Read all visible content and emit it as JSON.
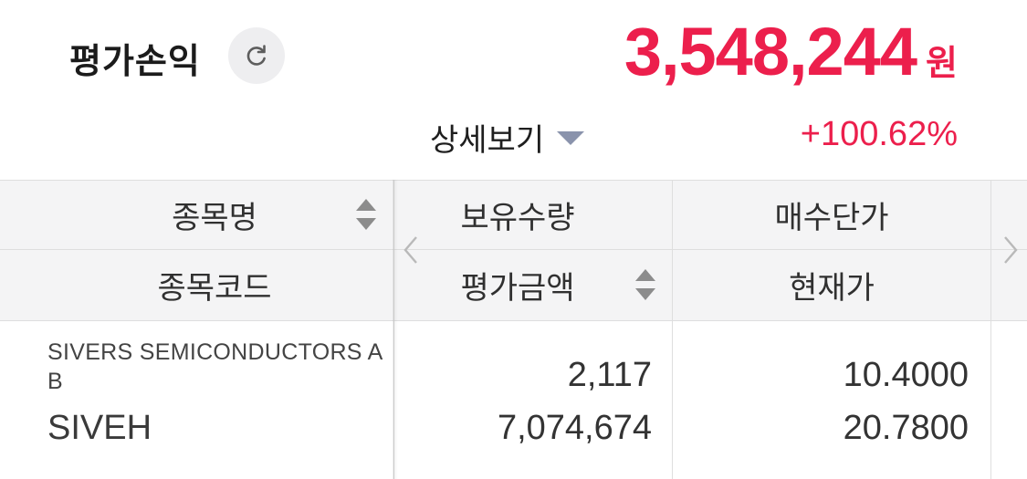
{
  "header": {
    "title": "평가손익",
    "refresh_icon": "refresh-icon",
    "amount": "3,548,244",
    "amount_unit": "원",
    "detail_label": "상세보기",
    "return_pct": "+100.62%",
    "accent_color": "#ec1f4c"
  },
  "table": {
    "headers": {
      "col1_row1": "종목명",
      "col1_row2": "종목코드",
      "col2_row1": "보유수량",
      "col2_row2": "평가금액",
      "col3_row1": "매수단가",
      "col3_row2": "현재가"
    },
    "rows": [
      {
        "name": "SIVERS SEMICONDUCTORS AB",
        "code": "SIVEH",
        "quantity": "2,117",
        "eval_amount": "7,074,674",
        "buy_price": "10.4000",
        "current_price": "20.7800"
      }
    ]
  }
}
